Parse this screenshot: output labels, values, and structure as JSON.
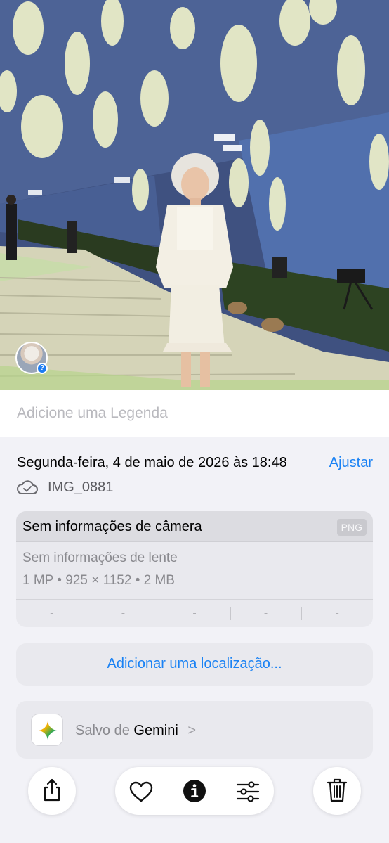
{
  "photo": {
    "avatar_badge": "question-badge"
  },
  "caption": {
    "placeholder": "Adicione uma Legenda"
  },
  "info": {
    "date": "Segunda-feira, 4 de maio de 2026 às 18:48",
    "adjust_label": "Ajustar",
    "cloud_icon": "cloud-check-icon",
    "filename": "IMG_0881"
  },
  "camera": {
    "title": "Sem informações de câmera",
    "format_badge": "PNG",
    "lens": "Sem informações de lente",
    "specs": "1 MP • 925 × 1152 • 2 MB",
    "stats": [
      "-",
      "-",
      "-",
      "-",
      "-"
    ]
  },
  "location": {
    "add_label": "Adicionar uma localização..."
  },
  "saved_from": {
    "prefix": "Salvo de",
    "app_name": "Gemini",
    "chevron": ">"
  },
  "toolbar": {
    "share_icon": "share-icon",
    "favorite_icon": "heart-icon",
    "info_icon": "info-icon",
    "adjust_icon": "sliders-icon",
    "delete_icon": "trash-icon"
  },
  "colors": {
    "accent": "#1a82f4",
    "background": "#f2f2f7",
    "card": "#e9e9ee"
  }
}
